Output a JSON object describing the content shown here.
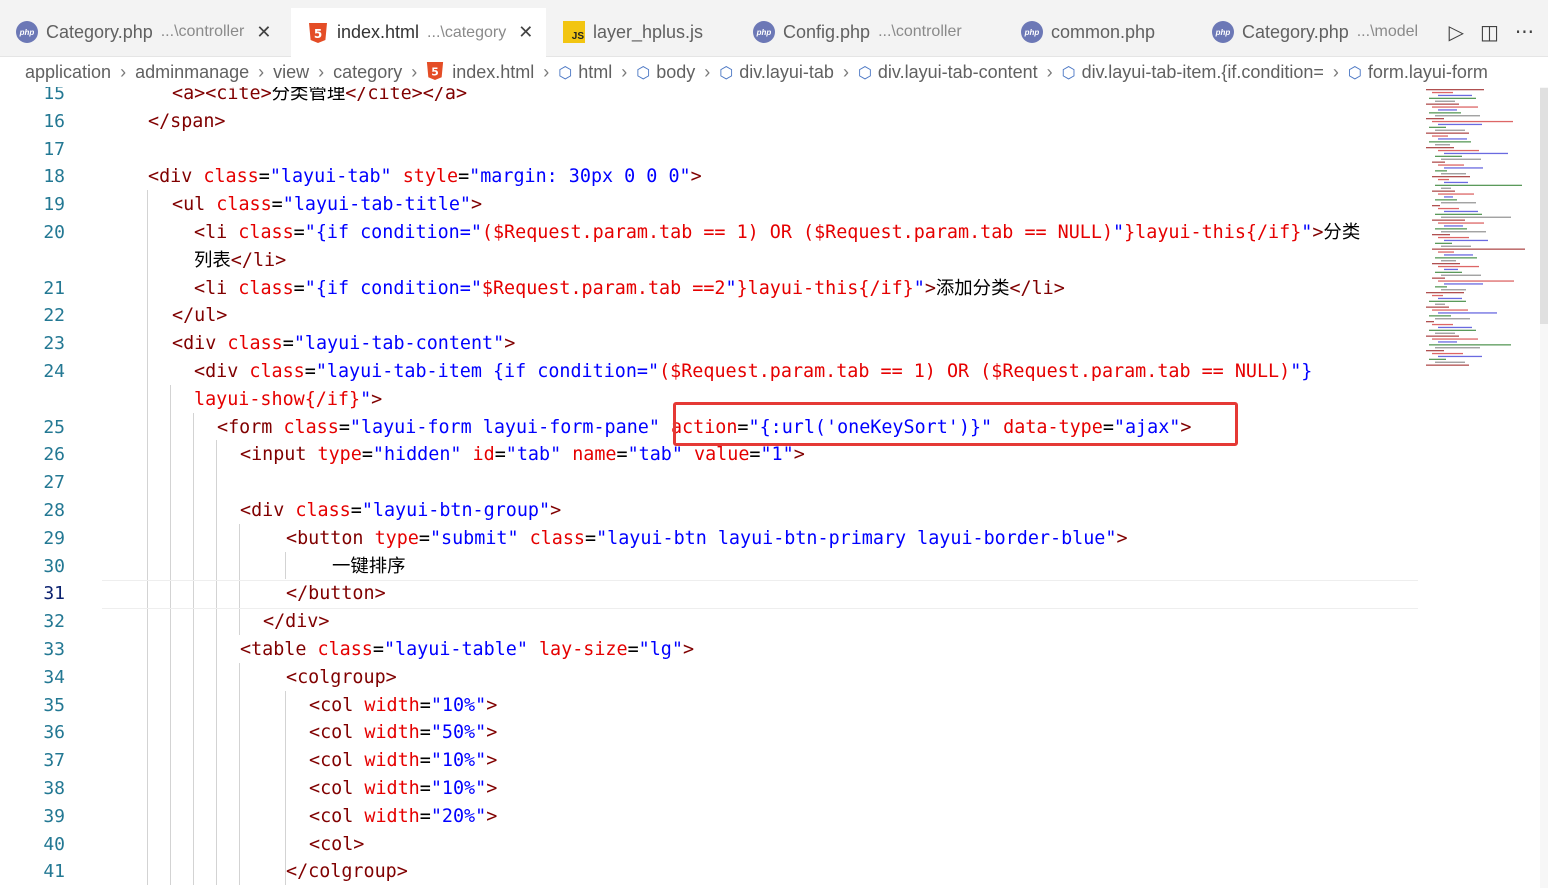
{
  "tabs": [
    {
      "name": "Category.php",
      "desc": "...\\controller",
      "icon": "php-file-icon",
      "active": false,
      "close": "✕"
    },
    {
      "name": "index.html",
      "desc": "...\\category",
      "icon": "html5-file-icon",
      "active": true,
      "close": "✕"
    },
    {
      "name": "layer_hplus.js",
      "desc": "",
      "icon": "js-file-icon",
      "active": false
    },
    {
      "name": "Config.php",
      "desc": "...\\controller",
      "icon": "php-file-icon",
      "active": false
    },
    {
      "name": "common.php",
      "desc": "",
      "icon": "php-file-icon",
      "active": false
    },
    {
      "name": "Category.php",
      "desc": "...\\model",
      "icon": "php-file-icon",
      "active": false
    }
  ],
  "tab_actions": [
    {
      "icon": "run-icon",
      "glyph": "▷"
    },
    {
      "icon": "split-editor-icon",
      "glyph": "◫"
    },
    {
      "icon": "more-actions-icon",
      "glyph": "···"
    }
  ],
  "icon_labels": {
    "php": "php",
    "js": "JS",
    "html": "5"
  },
  "breadcrumbs": [
    "application",
    "adminmanage",
    "view",
    "category",
    "index.html",
    "html",
    "body",
    "div.layui-tab",
    "div.layui-tab-content",
    "div.layui-tab-item.{if.condition=",
    "form.layui-form"
  ],
  "breadcrumb_separator": "›",
  "line_numbers": [
    "15",
    "16",
    "17",
    "18",
    "19",
    "20",
    "",
    "21",
    "22",
    "23",
    "24",
    "",
    "25",
    "26",
    "27",
    "28",
    "29",
    "30",
    "31",
    "32",
    "33",
    "34",
    "35",
    "36",
    "37",
    "38",
    "39",
    "40",
    "41"
  ],
  "current_line_number": "31",
  "code_lines": [
    [
      {
        "c": "t",
        "v": "<a><cite>"
      },
      {
        "c": "x",
        "v": "分类管理"
      },
      {
        "c": "t",
        "v": "</cite></a>"
      }
    ],
    [
      {
        "c": "t",
        "v": "</span>"
      }
    ],
    [],
    [
      {
        "c": "t",
        "v": "<div "
      },
      {
        "c": "a",
        "v": "class"
      },
      {
        "c": "x",
        "v": "="
      },
      {
        "c": "s",
        "v": "\"layui-tab\" "
      },
      {
        "c": "a",
        "v": "style"
      },
      {
        "c": "x",
        "v": "="
      },
      {
        "c": "s",
        "v": "\"margin: 30px 0 0 0\""
      },
      {
        "c": "t",
        "v": ">"
      }
    ],
    [
      {
        "c": "t",
        "v": "<ul "
      },
      {
        "c": "a",
        "v": "class"
      },
      {
        "c": "x",
        "v": "="
      },
      {
        "c": "s",
        "v": "\"layui-tab-title\""
      },
      {
        "c": "t",
        "v": ">"
      }
    ],
    [
      {
        "c": "t",
        "v": "<li "
      },
      {
        "c": "a",
        "v": "class"
      },
      {
        "c": "x",
        "v": "="
      },
      {
        "c": "s",
        "v": "\"{if condition=\""
      },
      {
        "c": "a",
        "v": "($Request.param.tab == 1) OR ($Request.param.tab == NULL)"
      },
      {
        "c": "s",
        "v": "\""
      },
      {
        "c": "a",
        "v": "}layui-this{/if}"
      },
      {
        "c": "s",
        "v": "\""
      },
      {
        "c": "t",
        "v": ">"
      },
      {
        "c": "x",
        "v": "分类"
      }
    ],
    [
      {
        "c": "x",
        "v": "列表"
      },
      {
        "c": "t",
        "v": "</li>"
      }
    ],
    [
      {
        "c": "t",
        "v": "<li "
      },
      {
        "c": "a",
        "v": "class"
      },
      {
        "c": "x",
        "v": "="
      },
      {
        "c": "s",
        "v": "\"{if condition=\""
      },
      {
        "c": "a",
        "v": "$Request.param.tab ==2"
      },
      {
        "c": "s",
        "v": "\""
      },
      {
        "c": "a",
        "v": "}layui-this{/if}"
      },
      {
        "c": "s",
        "v": "\""
      },
      {
        "c": "t",
        "v": ">"
      },
      {
        "c": "x",
        "v": "添加分类"
      },
      {
        "c": "t",
        "v": "</li>"
      }
    ],
    [
      {
        "c": "t",
        "v": "</ul>"
      }
    ],
    [
      {
        "c": "t",
        "v": "<div "
      },
      {
        "c": "a",
        "v": "class"
      },
      {
        "c": "x",
        "v": "="
      },
      {
        "c": "s",
        "v": "\"layui-tab-content\""
      },
      {
        "c": "t",
        "v": ">"
      }
    ],
    [
      {
        "c": "t",
        "v": "<div "
      },
      {
        "c": "a",
        "v": "class"
      },
      {
        "c": "x",
        "v": "="
      },
      {
        "c": "s",
        "v": "\"layui-tab-item {if condition=\""
      },
      {
        "c": "a",
        "v": "($Request.param.tab == 1) OR ($Request.param.tab == NULL)"
      },
      {
        "c": "s",
        "v": "\"}"
      }
    ],
    [
      {
        "c": "a",
        "v": "layui-show{/if}"
      },
      {
        "c": "s",
        "v": "\""
      },
      {
        "c": "t",
        "v": ">"
      }
    ],
    [
      {
        "c": "t",
        "v": "<form "
      },
      {
        "c": "a",
        "v": "class"
      },
      {
        "c": "x",
        "v": "="
      },
      {
        "c": "s",
        "v": "\"layui-form layui-form-pane\" "
      },
      {
        "c": "a",
        "v": "action"
      },
      {
        "c": "x",
        "v": "="
      },
      {
        "c": "s",
        "v": "\"{:url('oneKeySort')}\" "
      },
      {
        "c": "a",
        "v": "data-type"
      },
      {
        "c": "x",
        "v": "="
      },
      {
        "c": "s",
        "v": "\"ajax\""
      },
      {
        "c": "t",
        "v": ">"
      }
    ],
    [
      {
        "c": "t",
        "v": "<input "
      },
      {
        "c": "a",
        "v": "type"
      },
      {
        "c": "x",
        "v": "="
      },
      {
        "c": "s",
        "v": "\"hidden\" "
      },
      {
        "c": "a",
        "v": "id"
      },
      {
        "c": "x",
        "v": "="
      },
      {
        "c": "s",
        "v": "\"tab\" "
      },
      {
        "c": "a",
        "v": "name"
      },
      {
        "c": "x",
        "v": "="
      },
      {
        "c": "s",
        "v": "\"tab\" "
      },
      {
        "c": "a",
        "v": "value"
      },
      {
        "c": "x",
        "v": "="
      },
      {
        "c": "s",
        "v": "\"1\""
      },
      {
        "c": "t",
        "v": ">"
      }
    ],
    [],
    [
      {
        "c": "t",
        "v": "<div "
      },
      {
        "c": "a",
        "v": "class"
      },
      {
        "c": "x",
        "v": "="
      },
      {
        "c": "s",
        "v": "\"layui-btn-group\""
      },
      {
        "c": "t",
        "v": ">"
      }
    ],
    [
      {
        "c": "t",
        "v": "<button "
      },
      {
        "c": "a",
        "v": "type"
      },
      {
        "c": "x",
        "v": "="
      },
      {
        "c": "s",
        "v": "\"submit\" "
      },
      {
        "c": "a",
        "v": "class"
      },
      {
        "c": "x",
        "v": "="
      },
      {
        "c": "s",
        "v": "\"layui-btn layui-btn-primary layui-border-blue\""
      },
      {
        "c": "t",
        "v": ">"
      }
    ],
    [
      {
        "c": "x",
        "v": "一键排序"
      }
    ],
    [
      {
        "c": "t",
        "v": "</button>"
      }
    ],
    [
      {
        "c": "t",
        "v": "</div>"
      }
    ],
    [
      {
        "c": "t",
        "v": "<table "
      },
      {
        "c": "a",
        "v": "class"
      },
      {
        "c": "x",
        "v": "="
      },
      {
        "c": "s",
        "v": "\"layui-table\" "
      },
      {
        "c": "a",
        "v": "lay-size"
      },
      {
        "c": "x",
        "v": "="
      },
      {
        "c": "s",
        "v": "\"lg\""
      },
      {
        "c": "t",
        "v": ">"
      }
    ],
    [
      {
        "c": "t",
        "v": "<colgroup>"
      }
    ],
    [
      {
        "c": "t",
        "v": "<col "
      },
      {
        "c": "a",
        "v": "width"
      },
      {
        "c": "x",
        "v": "="
      },
      {
        "c": "s",
        "v": "\"10%\""
      },
      {
        "c": "t",
        "v": ">"
      }
    ],
    [
      {
        "c": "t",
        "v": "<col "
      },
      {
        "c": "a",
        "v": "width"
      },
      {
        "c": "x",
        "v": "="
      },
      {
        "c": "s",
        "v": "\"50%\""
      },
      {
        "c": "t",
        "v": ">"
      }
    ],
    [
      {
        "c": "t",
        "v": "<col "
      },
      {
        "c": "a",
        "v": "width"
      },
      {
        "c": "x",
        "v": "="
      },
      {
        "c": "s",
        "v": "\"10%\""
      },
      {
        "c": "t",
        "v": ">"
      }
    ],
    [
      {
        "c": "t",
        "v": "<col "
      },
      {
        "c": "a",
        "v": "width"
      },
      {
        "c": "x",
        "v": "="
      },
      {
        "c": "s",
        "v": "\"10%\""
      },
      {
        "c": "t",
        "v": ">"
      }
    ],
    [
      {
        "c": "t",
        "v": "<col "
      },
      {
        "c": "a",
        "v": "width"
      },
      {
        "c": "x",
        "v": "="
      },
      {
        "c": "s",
        "v": "\"20%\""
      },
      {
        "c": "t",
        "v": ">"
      }
    ],
    [
      {
        "c": "t",
        "v": "<col>"
      }
    ],
    [
      {
        "c": "t",
        "v": "</colgroup>"
      }
    ]
  ],
  "colors": {
    "tag": "#800000",
    "attribute": "#e50000",
    "string": "#0000ff",
    "line_number": "#237893",
    "highlight_box": "#e53935",
    "tab_bar": "#f3f3f3"
  }
}
